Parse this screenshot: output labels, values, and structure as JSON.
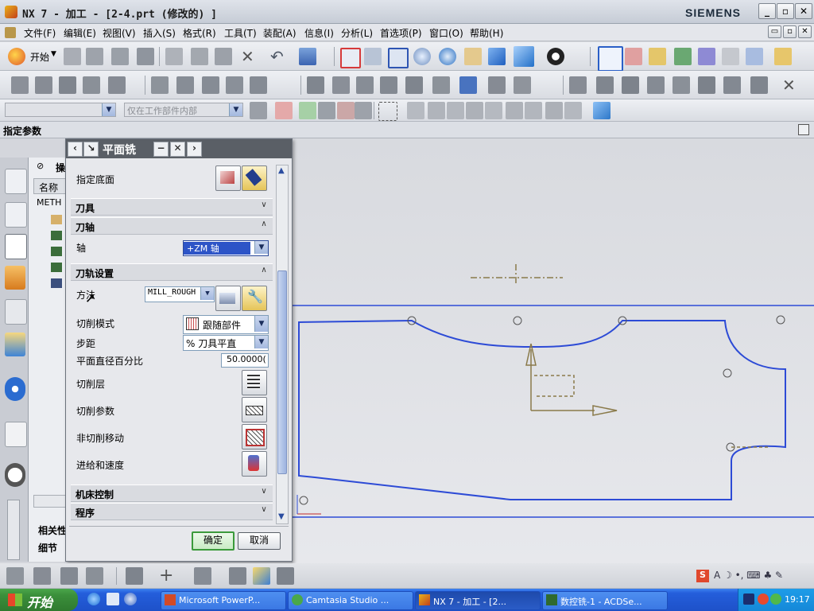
{
  "window": {
    "title": "NX 7 - 加工 - [2-4.prt (修改的) ]",
    "brand": "SIEMENS"
  },
  "menu": [
    "文件(F)",
    "编辑(E)",
    "视图(V)",
    "插入(S)",
    "格式(R)",
    "工具(T)",
    "装配(A)",
    "信息(I)",
    "分析(L)",
    "首选项(P)",
    "窗口(O)",
    "帮助(H)"
  ],
  "toolbar": {
    "start_label": "开始",
    "selection_filter_placeholder": "",
    "scope_value": "仅在工作部件内部"
  },
  "status": {
    "prompt": "指定参数"
  },
  "navigator": {
    "column_name": "名称",
    "root": "METH",
    "section_related": "相关性",
    "section_detail": "细节"
  },
  "dialog": {
    "title": "平面铣",
    "floor_label": "指定底面",
    "tool_section": "刀具",
    "axis_section": "刀轴",
    "axis_label": "轴",
    "axis_value": "+ZM 轴",
    "path_section": "刀轨设置",
    "method_label": "方法",
    "method_value": "MILL_ROUGH",
    "cut_pattern_label": "切削模式",
    "cut_pattern_value": "跟随部件",
    "stepover_label": "步距",
    "stepover_value": "% 刀具平直",
    "flat_diameter_label": "平面直径百分比",
    "flat_diameter_value": "50.0000(",
    "cut_levels_label": "切削层",
    "cut_params_label": "切削参数",
    "non_cut_label": "非切削移动",
    "feeds_label": "进给和速度",
    "machine_section": "机床控制",
    "program_section": "程序",
    "ok_label": "确定",
    "cancel_label": "取消"
  },
  "taskbar": {
    "start": "开始",
    "tasks": [
      "Microsoft PowerP...",
      "Camtasia Studio ...",
      "NX 7 - 加工 - [2...",
      "数控铣-1 - ACDSe..."
    ],
    "clock": "19:17"
  },
  "colors": {
    "part_outline": "#2d4bd6",
    "csys": "#8a7a4a",
    "dialog_header": "#5a5f66"
  }
}
